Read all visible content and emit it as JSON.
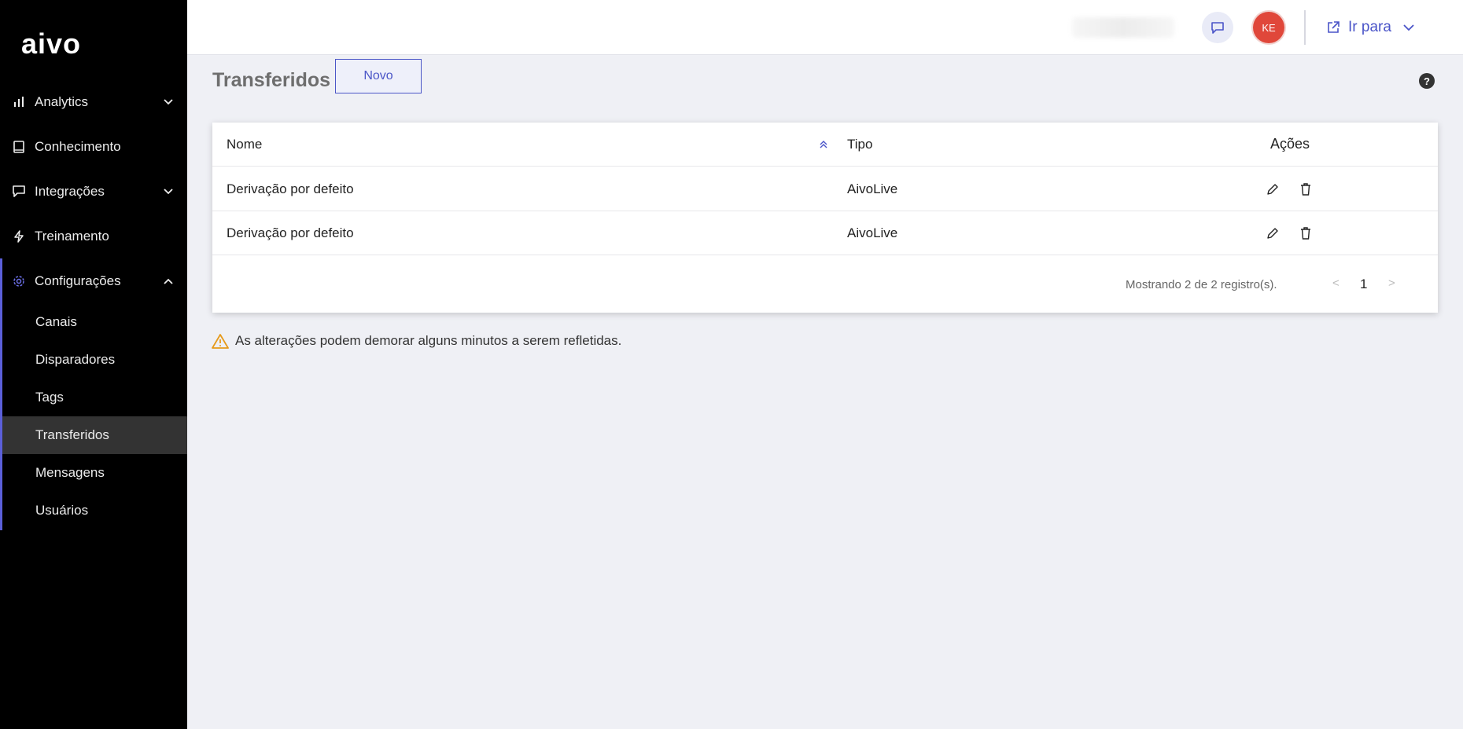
{
  "brand": {
    "logo_text": "aivo"
  },
  "sidebar": {
    "items": [
      {
        "label": "Analytics",
        "icon": "bar-chart-icon",
        "expandable": true
      },
      {
        "label": "Conhecimento",
        "icon": "book-icon",
        "expandable": false
      },
      {
        "label": "Integrações",
        "icon": "chat-bubble-icon",
        "expandable": true
      },
      {
        "label": "Treinamento",
        "icon": "lightning-icon",
        "expandable": false
      },
      {
        "label": "Configurações",
        "icon": "gear-icon",
        "expandable": true,
        "expanded": true
      }
    ],
    "sub_items": [
      {
        "label": "Canais"
      },
      {
        "label": "Disparadores"
      },
      {
        "label": "Tags"
      },
      {
        "label": "Transferidos",
        "active": true
      },
      {
        "label": "Mensagens"
      },
      {
        "label": "Usuários"
      }
    ],
    "accent_color": "#5b5fd9"
  },
  "topbar": {
    "avatar_initials": "KE",
    "goto_label": "Ir para"
  },
  "page": {
    "title": "Transferidos",
    "new_button": "Novo"
  },
  "table": {
    "columns": [
      "Nome",
      "Tipo",
      "Ações"
    ],
    "rows": [
      {
        "name": "Derivação por defeito",
        "type": "AivoLive"
      },
      {
        "name": "Derivação por defeito",
        "type": "AivoLive"
      }
    ],
    "records_text": "Mostrando 2 de 2 registro(s).",
    "pager": {
      "prev": "<",
      "page": "1",
      "next": ">"
    }
  },
  "notice": {
    "text": "As alterações podem demorar alguns minutos a serem refletidas.",
    "icon": "warning-icon",
    "color": "#e69a1a"
  }
}
